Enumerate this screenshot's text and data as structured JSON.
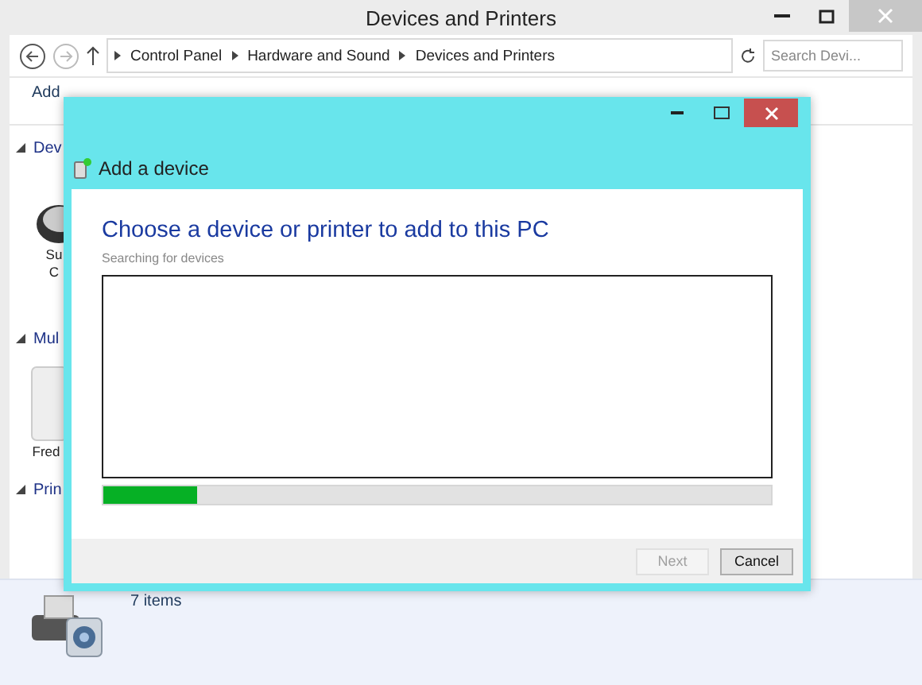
{
  "window": {
    "title": "Devices and Printers"
  },
  "address_bar": {
    "breadcrumbs": [
      "Control Panel",
      "Hardware and Sound",
      "Devices and Printers"
    ]
  },
  "search": {
    "placeholder": "Search Devi..."
  },
  "toolbar": {
    "label": "Add"
  },
  "groups": [
    {
      "label": "Dev",
      "expanded": true,
      "devices": [
        {
          "label_lines": [
            "Su",
            "C"
          ],
          "kind": "keyboard"
        }
      ]
    },
    {
      "label": "Mul",
      "expanded": true,
      "devices": [
        {
          "label_lines": [
            "Fred"
          ],
          "kind": "media"
        }
      ]
    },
    {
      "label": "Prin",
      "expanded": true
    }
  ],
  "status_bar": {
    "count": "7 items"
  },
  "dialog": {
    "title": "Add a device",
    "heading": "Choose a device or printer to add to this PC",
    "status": "Searching for devices",
    "progress": {
      "level": 0.14
    },
    "buttons": [
      {
        "label": "Next",
        "disabled": true
      },
      {
        "label": "Cancel",
        "disabled": false
      }
    ]
  }
}
